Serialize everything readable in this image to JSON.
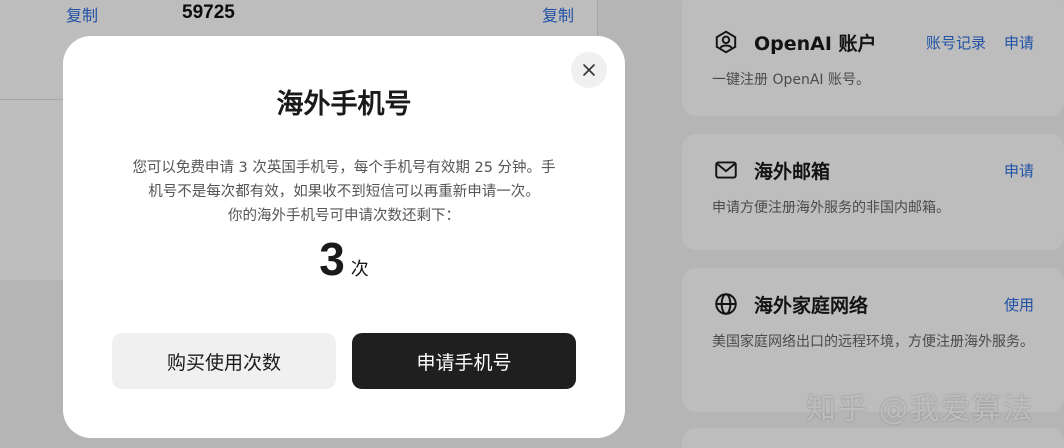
{
  "background": {
    "copy_left": "复制",
    "code": "59725",
    "copy_right": "复制",
    "cards": [
      {
        "icon": "user-icon",
        "title": "OpenAI 账户",
        "actions": [
          "账号记录",
          "申请"
        ],
        "desc": "一键注册 OpenAI 账号。"
      },
      {
        "icon": "mail-icon",
        "title": "海外邮箱",
        "actions": [
          "申请"
        ],
        "desc": "申请方便注册海外服务的非国内邮箱。"
      },
      {
        "icon": "globe-icon",
        "title": "海外家庭网络",
        "actions": [
          "使用"
        ],
        "desc": "美国家庭网络出口的远程环境，方便注册海外服务。"
      }
    ]
  },
  "watermark": "知乎 @我爱算法",
  "modal": {
    "title": "海外手机号",
    "desc_line1": "您可以免费申请 3 次英国手机号，每个手机号有效期 25 分钟。手",
    "desc_line2": "机号不是每次都有效，如果收不到短信可以再重新申请一次。",
    "desc_line3": "你的海外手机号可申请次数还剩下：",
    "count": "3",
    "count_unit": "次",
    "buy_button": "购买使用次数",
    "apply_button": "申请手机号"
  },
  "colors": {
    "link": "#2f6fe0",
    "primary_button": "#1f1f1f",
    "secondary_button": "#f0f0f0"
  }
}
